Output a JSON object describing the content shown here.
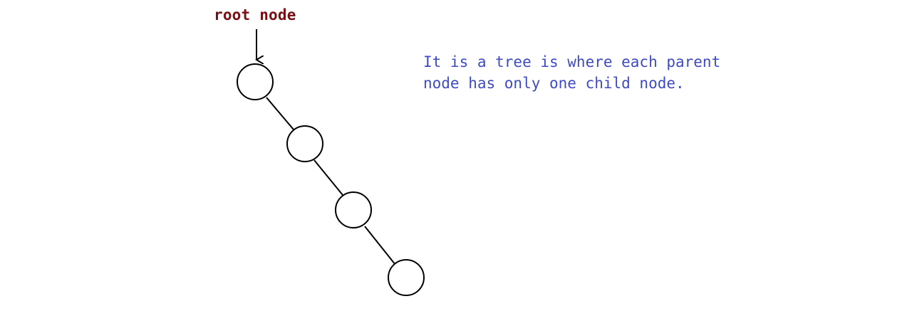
{
  "diagram": {
    "root_label": "root node",
    "description_lines": [
      "It is a tree is where each parent",
      "node has only one child node."
    ],
    "colors": {
      "root_label": "#7a0f14",
      "description": "#3f4bc2",
      "stroke": "#000000"
    },
    "node_count": 4
  }
}
